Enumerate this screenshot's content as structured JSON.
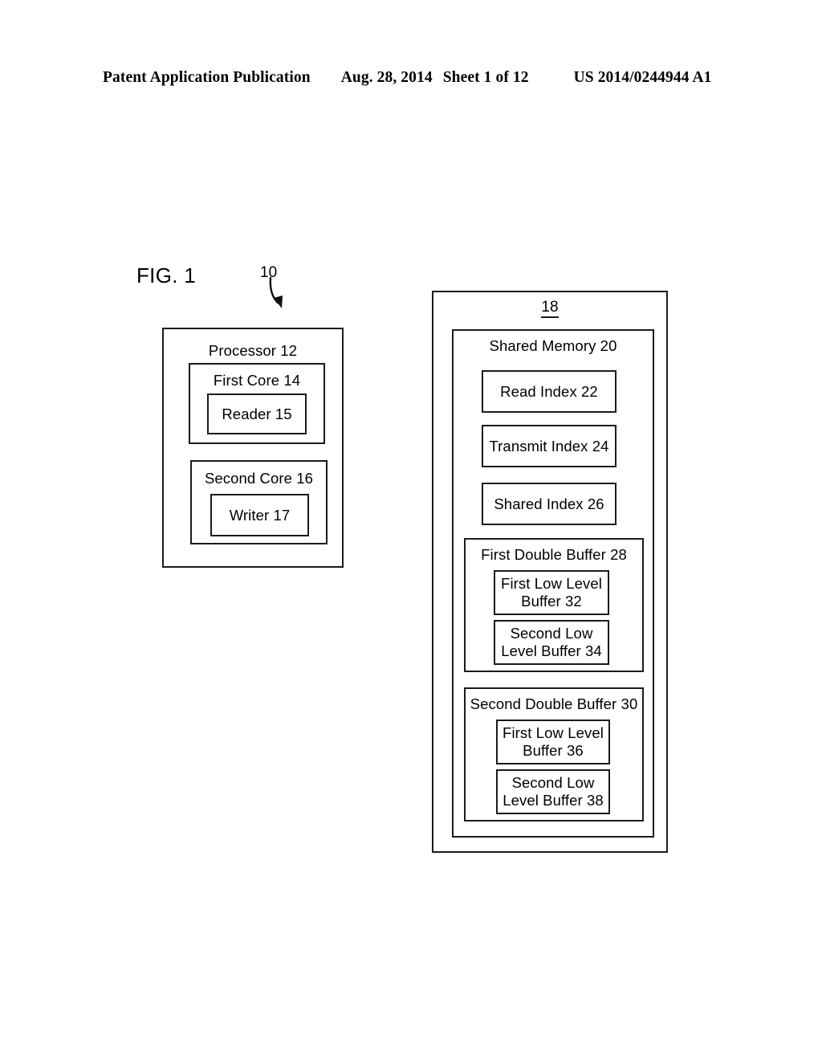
{
  "header": {
    "publication": "Patent Application Publication",
    "date": "Aug. 28, 2014",
    "sheet": "Sheet 1 of 12",
    "patent_number": "US 2014/0244944 A1"
  },
  "figure": {
    "label": "FIG. 1",
    "system_reference": "10"
  },
  "processor": {
    "title": "Processor 12",
    "first_core": {
      "title": "First Core 14",
      "reader": "Reader 15"
    },
    "second_core": {
      "title": "Second Core 16",
      "writer": "Writer 17"
    }
  },
  "system": {
    "reference": "18",
    "shared_memory": {
      "title": "Shared Memory 20",
      "indexes": [
        "Read Index 22",
        "Transmit Index 24",
        "Shared Index 26"
      ],
      "first_double_buffer": {
        "title": "First Double Buffer 28",
        "first_low_level_buffer": "First Low Level\nBuffer 32",
        "second_low_level_buffer": "Second Low\nLevel Buffer 34"
      },
      "second_double_buffer": {
        "title": "Second Double Buffer 30",
        "first_low_level_buffer": "First Low Level\nBuffer 36",
        "second_low_level_buffer": "Second Low\nLevel Buffer 38"
      }
    }
  }
}
